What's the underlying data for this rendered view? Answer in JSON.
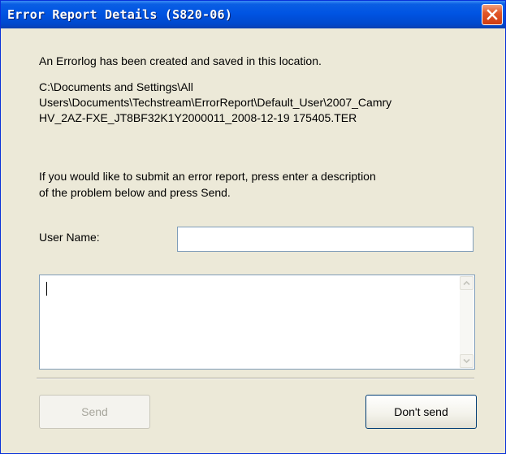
{
  "window": {
    "title": "Error Report Details (S820-06)"
  },
  "body": {
    "intro": "An Errorlog has been created and saved in this location.",
    "path_lines": [
      "C:\\Documents and Settings\\All",
      "Users\\Documents\\Techstream\\ErrorReport\\Default_User\\2007_Camry",
      "HV_2AZ-FXE_JT8BF32K1Y2000011_2008-12-19 175405.TER"
    ],
    "instructions_lines": [
      "If you would like to submit an error report, press enter a description",
      "of the problem below and press Send."
    ]
  },
  "form": {
    "user_name_label": "User Name:",
    "user_name_value": "",
    "description_value": ""
  },
  "buttons": {
    "send_label": "Send",
    "send_enabled": false,
    "dont_send_label": "Don't send"
  },
  "icons": {
    "close": "close-icon",
    "scroll_up": "scroll-up-arrow-icon",
    "scroll_down": "scroll-down-arrow-icon"
  },
  "colors": {
    "titlebar": "#0054e3",
    "dialog_background": "#ece9d8",
    "close_button": "#e2582a",
    "disabled_text": "#a7a69c"
  }
}
